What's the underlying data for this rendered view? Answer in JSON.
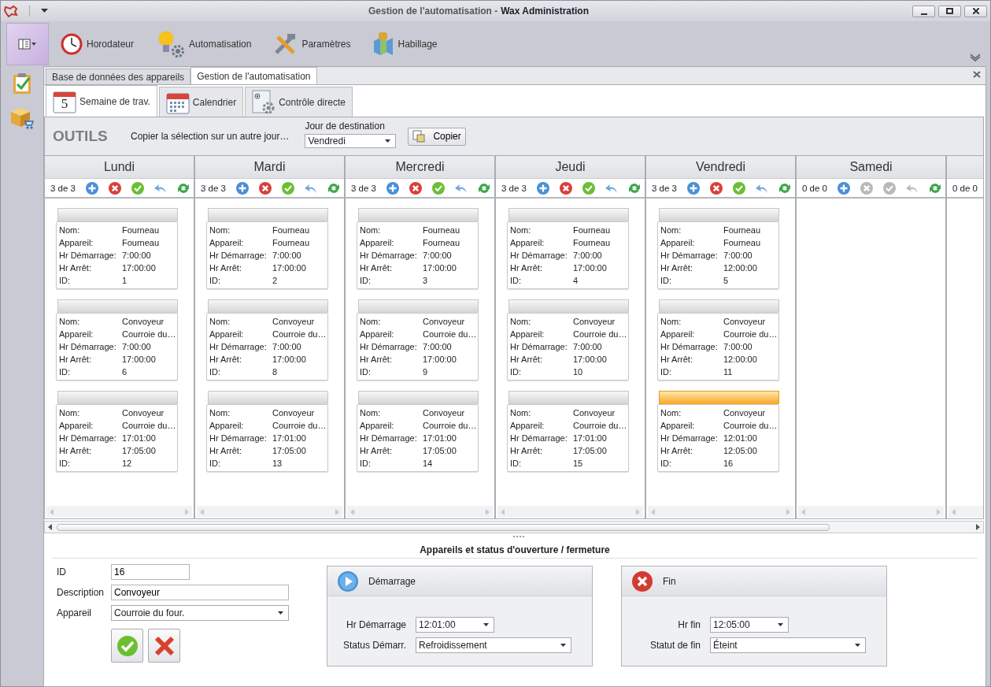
{
  "window": {
    "title_part": "Gestion de l'automatisation -",
    "title_app": "Wax Administration"
  },
  "ribbon": {
    "items": [
      {
        "kind": "clock",
        "label": "Horodateur"
      },
      {
        "kind": "bulb",
        "label": "Automatisation"
      },
      {
        "kind": "tools",
        "label": "Paramètres"
      },
      {
        "kind": "skin",
        "label": "Habillage"
      }
    ]
  },
  "sidebar": {
    "items": [
      {
        "kind": "clipboard"
      },
      {
        "kind": "box"
      }
    ]
  },
  "doc_tabs": [
    {
      "label": "Base de données des appareils",
      "selected": false
    },
    {
      "label": "Gestion de l'automatisation",
      "selected": true
    }
  ],
  "sub_tabs": [
    {
      "kind": "week",
      "badge": "5",
      "label": "Semaine de trav.",
      "selected": true
    },
    {
      "kind": "calendar",
      "label": "Calendrier",
      "selected": false
    },
    {
      "kind": "control",
      "label": "Contrôle directe",
      "selected": false
    }
  ],
  "tools": {
    "title": "OUTILS",
    "copy_text": "Copier la sélection sur un autre jour…",
    "dest_label": "Jour de destination",
    "dest_value": "Vendredi",
    "copy_button": "Copier"
  },
  "days": [
    {
      "name": "Lundi",
      "count": "3 de 3",
      "editable": true,
      "cards": [
        {
          "selected": false,
          "fields": [
            [
              "Nom:",
              "Fourneau"
            ],
            [
              "Appareil:",
              "Fourneau"
            ],
            [
              "Hr Démarrage:",
              "7:00:00"
            ],
            [
              "Hr Arrêt:",
              "17:00:00"
            ],
            [
              "ID:",
              "1"
            ]
          ]
        },
        {
          "selected": false,
          "fields": [
            [
              "Nom:",
              "Convoyeur"
            ],
            [
              "Appareil:",
              "Courroie du…"
            ],
            [
              "Hr Démarrage:",
              "7:00:00"
            ],
            [
              "Hr Arrêt:",
              "17:00:00"
            ],
            [
              "ID:",
              "6"
            ]
          ]
        },
        {
          "selected": false,
          "fields": [
            [
              "Nom:",
              "Convoyeur"
            ],
            [
              "Appareil:",
              "Courroie du…"
            ],
            [
              "Hr Démarrage:",
              "17:01:00"
            ],
            [
              "Hr Arrêt:",
              "17:05:00"
            ],
            [
              "ID:",
              "12"
            ]
          ]
        }
      ]
    },
    {
      "name": "Mardi",
      "count": "3 de 3",
      "editable": true,
      "cards": [
        {
          "selected": false,
          "fields": [
            [
              "Nom:",
              "Fourneau"
            ],
            [
              "Appareil:",
              "Fourneau"
            ],
            [
              "Hr Démarrage:",
              "7:00:00"
            ],
            [
              "Hr Arrêt:",
              "17:00:00"
            ],
            [
              "ID:",
              "2"
            ]
          ]
        },
        {
          "selected": false,
          "fields": [
            [
              "Nom:",
              "Convoyeur"
            ],
            [
              "Appareil:",
              "Courroie du…"
            ],
            [
              "Hr Démarrage:",
              "7:00:00"
            ],
            [
              "Hr Arrêt:",
              "17:00:00"
            ],
            [
              "ID:",
              "8"
            ]
          ]
        },
        {
          "selected": false,
          "fields": [
            [
              "Nom:",
              "Convoyeur"
            ],
            [
              "Appareil:",
              "Courroie du…"
            ],
            [
              "Hr Démarrage:",
              "17:01:00"
            ],
            [
              "Hr Arrêt:",
              "17:05:00"
            ],
            [
              "ID:",
              "13"
            ]
          ]
        }
      ]
    },
    {
      "name": "Mercredi",
      "count": "3 de 3",
      "editable": true,
      "cards": [
        {
          "selected": false,
          "fields": [
            [
              "Nom:",
              "Fourneau"
            ],
            [
              "Appareil:",
              "Fourneau"
            ],
            [
              "Hr Démarrage:",
              "7:00:00"
            ],
            [
              "Hr Arrêt:",
              "17:00:00"
            ],
            [
              "ID:",
              "3"
            ]
          ]
        },
        {
          "selected": false,
          "fields": [
            [
              "Nom:",
              "Convoyeur"
            ],
            [
              "Appareil:",
              "Courroie du…"
            ],
            [
              "Hr Démarrage:",
              "7:00:00"
            ],
            [
              "Hr Arrêt:",
              "17:00:00"
            ],
            [
              "ID:",
              "9"
            ]
          ]
        },
        {
          "selected": false,
          "fields": [
            [
              "Nom:",
              "Convoyeur"
            ],
            [
              "Appareil:",
              "Courroie du…"
            ],
            [
              "Hr Démarrage:",
              "17:01:00"
            ],
            [
              "Hr Arrêt:",
              "17:05:00"
            ],
            [
              "ID:",
              "14"
            ]
          ]
        }
      ]
    },
    {
      "name": "Jeudi",
      "count": "3 de 3",
      "editable": true,
      "cards": [
        {
          "selected": false,
          "fields": [
            [
              "Nom:",
              "Fourneau"
            ],
            [
              "Appareil:",
              "Fourneau"
            ],
            [
              "Hr Démarrage:",
              "7:00:00"
            ],
            [
              "Hr Arrêt:",
              "17:00:00"
            ],
            [
              "ID:",
              "4"
            ]
          ]
        },
        {
          "selected": false,
          "fields": [
            [
              "Nom:",
              "Convoyeur"
            ],
            [
              "Appareil:",
              "Courroie du…"
            ],
            [
              "Hr Démarrage:",
              "7:00:00"
            ],
            [
              "Hr Arrêt:",
              "17:00:00"
            ],
            [
              "ID:",
              "10"
            ]
          ]
        },
        {
          "selected": false,
          "fields": [
            [
              "Nom:",
              "Convoyeur"
            ],
            [
              "Appareil:",
              "Courroie du…"
            ],
            [
              "Hr Démarrage:",
              "17:01:00"
            ],
            [
              "Hr Arrêt:",
              "17:05:00"
            ],
            [
              "ID:",
              "15"
            ]
          ]
        }
      ]
    },
    {
      "name": "Vendredi",
      "count": "3 de 3",
      "editable": true,
      "cards": [
        {
          "selected": false,
          "fields": [
            [
              "Nom:",
              "Fourneau"
            ],
            [
              "Appareil:",
              "Fourneau"
            ],
            [
              "Hr Démarrage:",
              "7:00:00"
            ],
            [
              "Hr Arrêt:",
              "12:00:00"
            ],
            [
              "ID:",
              "5"
            ]
          ]
        },
        {
          "selected": false,
          "fields": [
            [
              "Nom:",
              "Convoyeur"
            ],
            [
              "Appareil:",
              "Courroie du…"
            ],
            [
              "Hr Démarrage:",
              "7:00:00"
            ],
            [
              "Hr Arrêt:",
              "12:00:00"
            ],
            [
              "ID:",
              "11"
            ]
          ]
        },
        {
          "selected": true,
          "fields": [
            [
              "Nom:",
              "Convoyeur"
            ],
            [
              "Appareil:",
              "Courroie du…"
            ],
            [
              "Hr Démarrage:",
              "12:01:00"
            ],
            [
              "Hr Arrêt:",
              "12:05:00"
            ],
            [
              "ID:",
              "16"
            ]
          ]
        }
      ]
    },
    {
      "name": "Samedi",
      "count": "0 de 0",
      "editable": false
    },
    {
      "count": "0 de 0"
    }
  ],
  "details": {
    "title": "Appareils et status d'ouverture / fermeture",
    "id_label": "ID",
    "id_value": "16",
    "desc_label": "Description",
    "desc_value": "Convoyeur",
    "device_label": "Appareil",
    "device_value": "Courroie du four.",
    "start": {
      "title": "Démarrage",
      "time_label": "Hr Démarrage",
      "time_value": "12:01:00",
      "status_label": "Status Démarr.",
      "status_value": "Refroidissement"
    },
    "end": {
      "title": "Fin",
      "time_label": "Hr fin",
      "time_value": "12:05:00",
      "status_label": "Statut de fin",
      "status_value": "Éteint"
    }
  }
}
